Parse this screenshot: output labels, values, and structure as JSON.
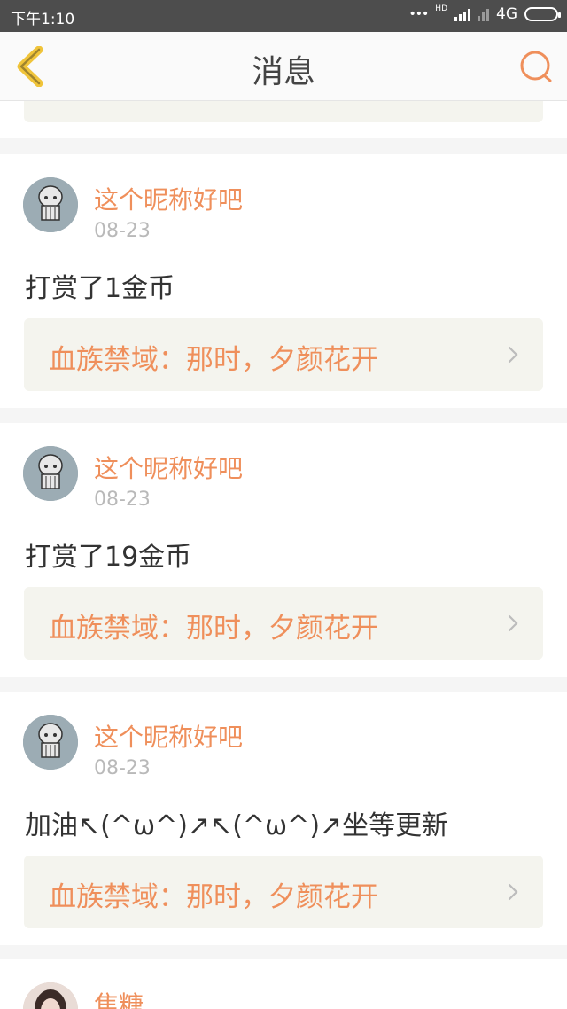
{
  "status_bar": {
    "time": "下午1:10",
    "network_hd": "HD",
    "network_type": "4G"
  },
  "nav": {
    "title": "消息"
  },
  "messages": [
    {
      "username": "这个昵称好吧",
      "date": "08-23",
      "text": "打赏了1金币",
      "link": "血族禁域：那时，夕颜花开"
    },
    {
      "username": "这个昵称好吧",
      "date": "08-23",
      "text": "打赏了19金币",
      "link": "血族禁域：那时，夕颜花开"
    },
    {
      "username": "这个昵称好吧",
      "date": "08-23",
      "text": "加油↖(^ω^)↗↖(^ω^)↗坐等更新",
      "link": "血族禁域：那时，夕颜花开"
    },
    {
      "username": "焦糖"
    }
  ],
  "colors": {
    "accent": "#ef8f5b",
    "back_icon": "#f0c43a",
    "link_bg": "#f4f4ee"
  },
  "icons": {
    "back": "chevron-left-icon",
    "search": "search-icon",
    "link_arrow": "chevron-right-icon"
  }
}
